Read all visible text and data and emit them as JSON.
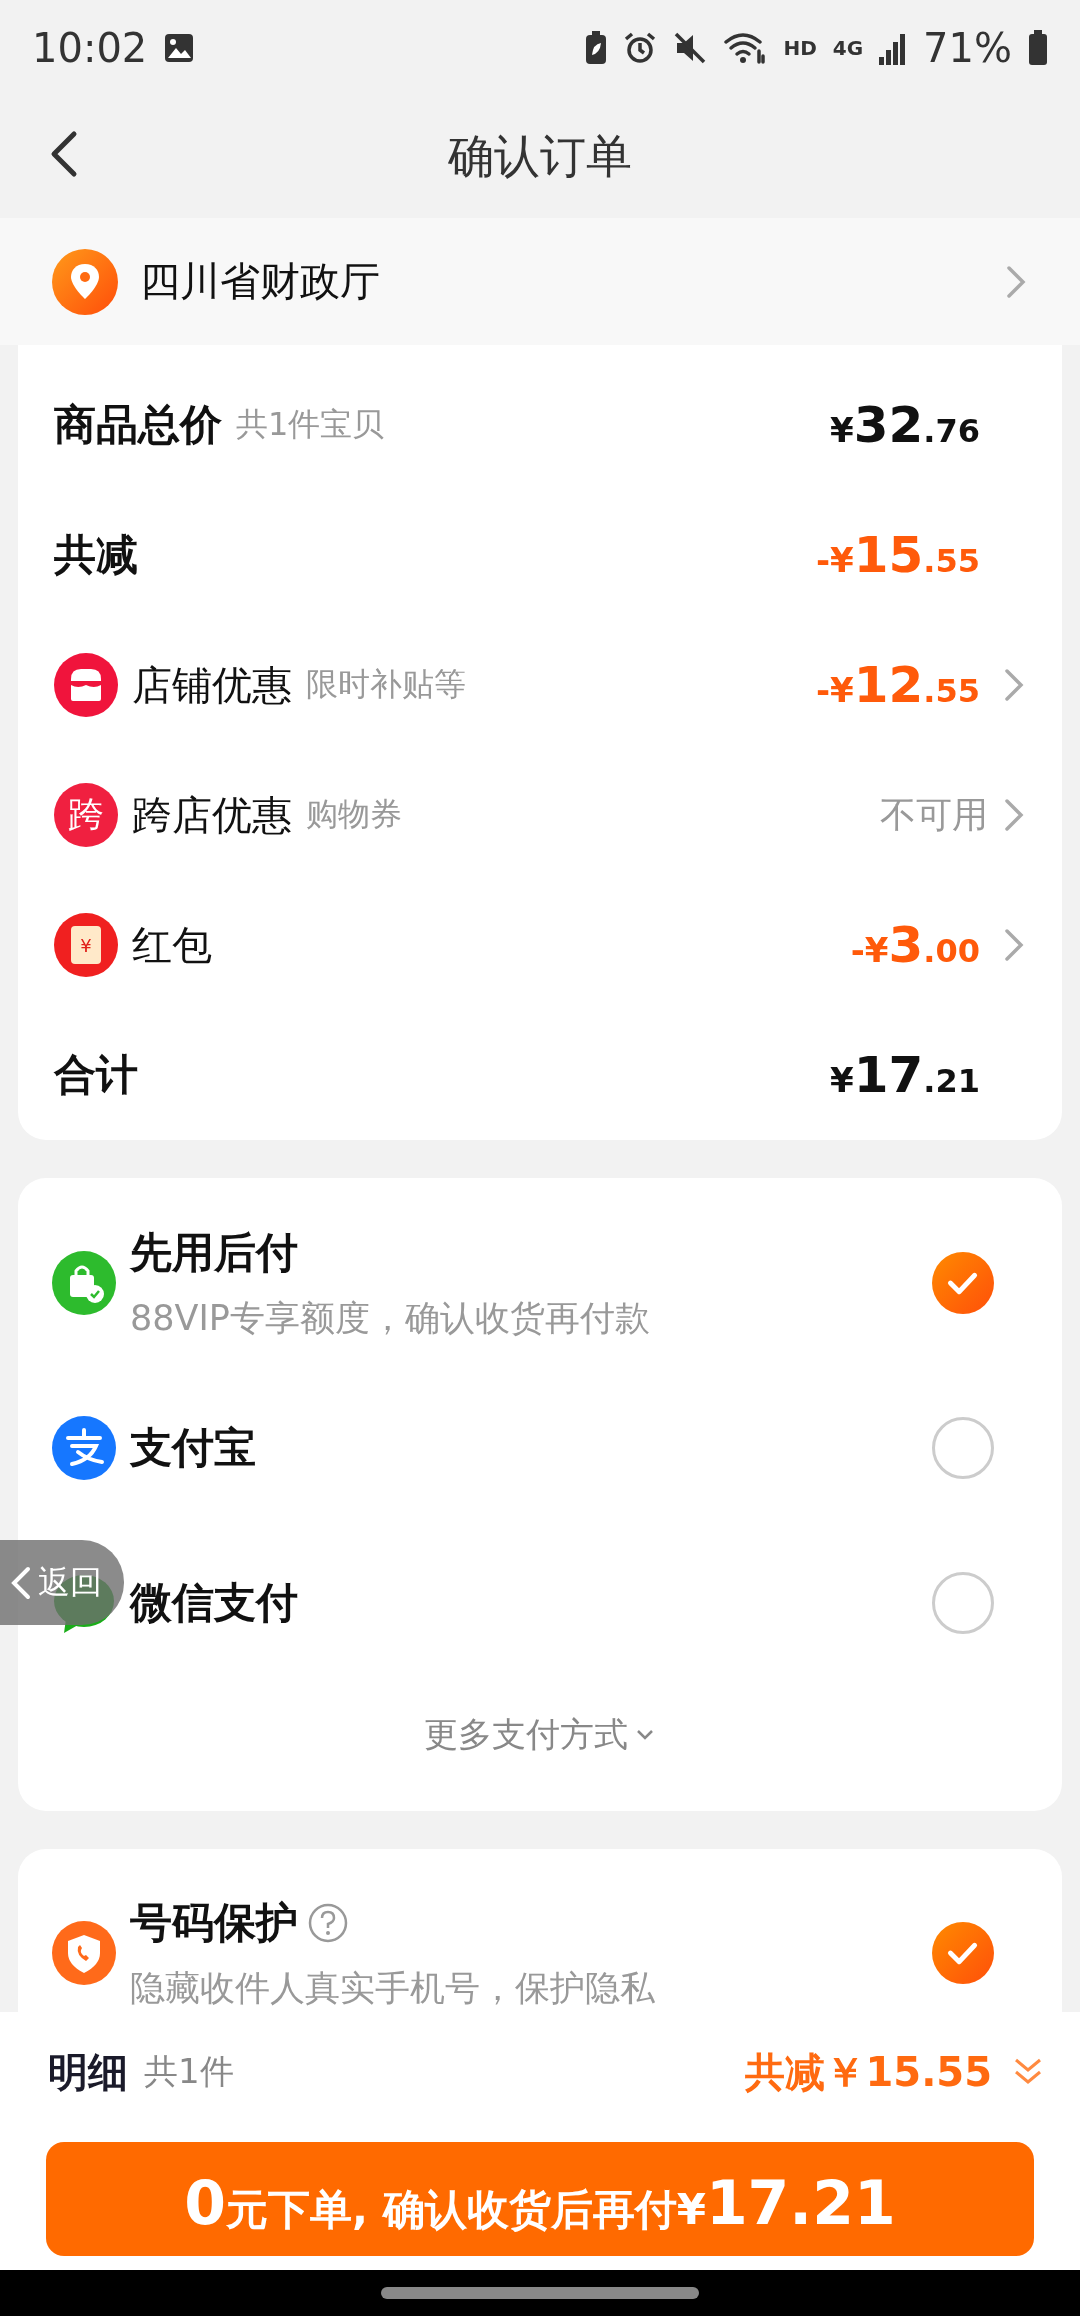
{
  "status_bar": {
    "time": "10:02",
    "network_hd": "HD",
    "network_gen": "4G",
    "battery": "71%"
  },
  "header": {
    "title": "确认订单"
  },
  "address": {
    "text": "四川省财政厅"
  },
  "summary": [
    {
      "kind": "total",
      "label": "商品总价",
      "note": "共1件宝贝",
      "price": {
        "prefix": "¥",
        "integer": "32",
        "decimal": ".76"
      }
    },
    {
      "kind": "reduction",
      "label": "共减",
      "price": {
        "prefix": "-¥",
        "integer": "15",
        "decimal": ".55"
      }
    },
    {
      "kind": "item",
      "label": "店铺优惠",
      "note": "限时补贴等",
      "price": {
        "prefix": "-¥",
        "integer": "12",
        "decimal": ".55"
      }
    },
    {
      "kind": "item",
      "icon_text": "跨",
      "label": "跨店优惠",
      "note": "购物券",
      "value": "不可用"
    },
    {
      "kind": "item",
      "icon_text": "¥",
      "label": "红包",
      "price": {
        "prefix": "-¥",
        "integer": "3",
        "decimal": ".00"
      }
    },
    {
      "kind": "total",
      "label": "合计",
      "price": {
        "prefix": "¥",
        "integer": "17",
        "decimal": ".21"
      }
    }
  ],
  "payment": {
    "options": [
      {
        "title": "先用后付",
        "subtitle": "88VIP专享额度，确认收货再付款",
        "selected": true
      },
      {
        "title": "支付宝",
        "selected": false
      },
      {
        "title": "微信支付",
        "selected": false
      }
    ],
    "more": "更多支付方式"
  },
  "protection": {
    "title": "号码保护",
    "subtitle": "隐藏收件人真实手机号，保护隐私",
    "checked": true
  },
  "floating_back": {
    "label": "返回"
  },
  "footer": {
    "label": "明细",
    "count": "共1件",
    "discount": "共减￥15.55"
  },
  "submit_button": {
    "lead": "0",
    "middle": "元下单, 确认收货后再付¥",
    "amount": "17.21"
  }
}
